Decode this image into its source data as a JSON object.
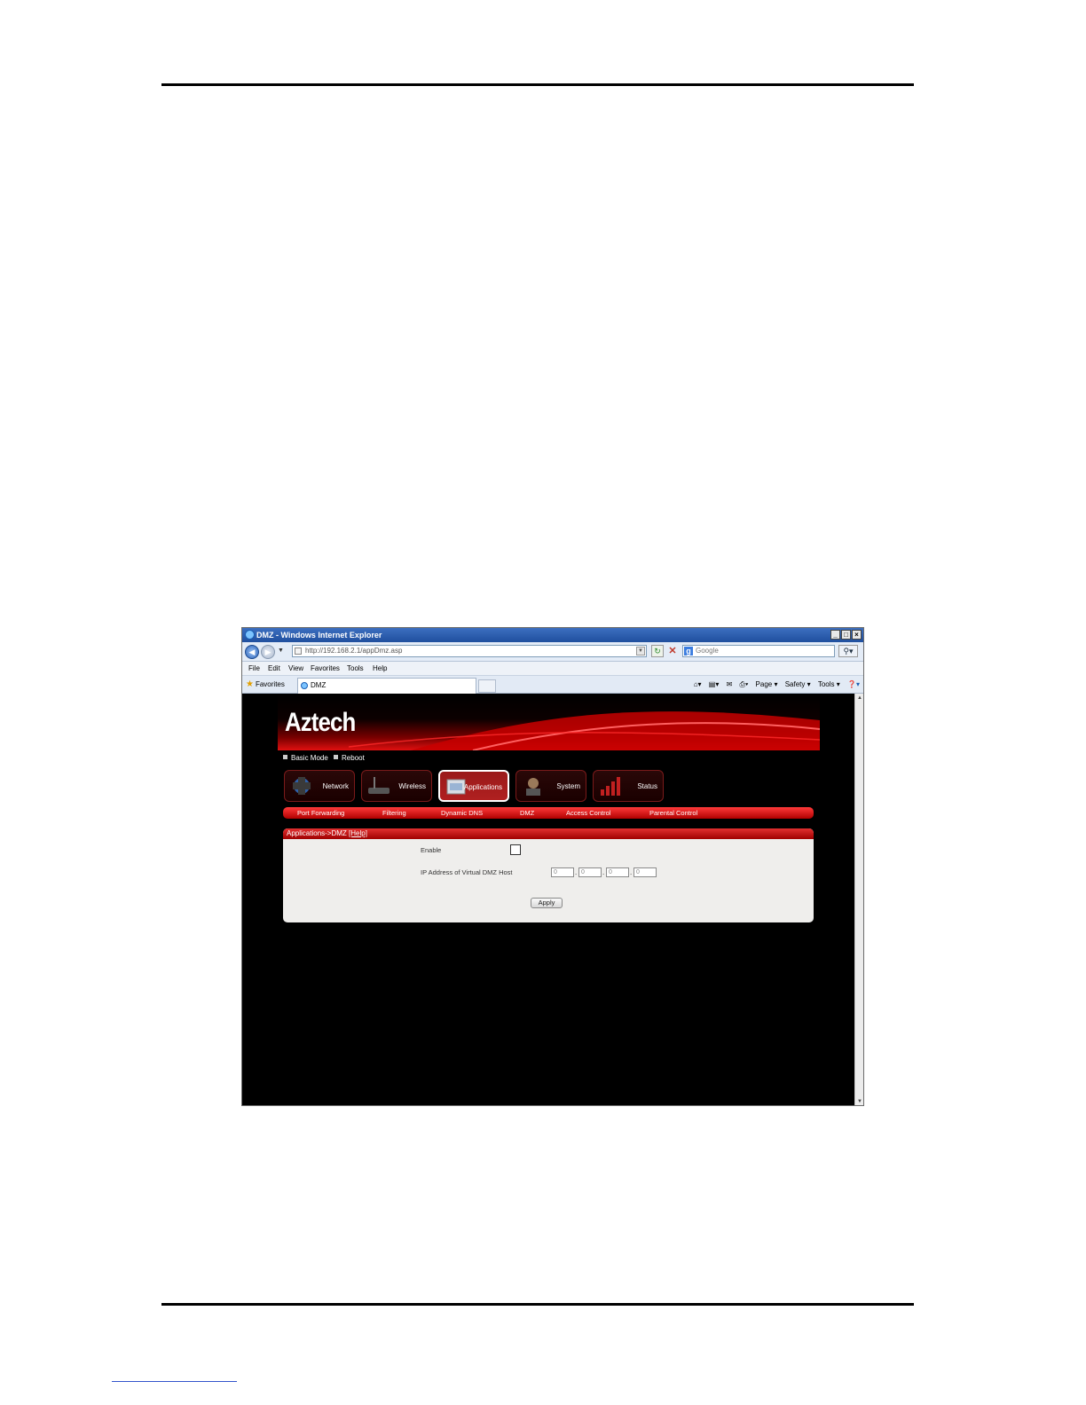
{
  "browser": {
    "window_title": "DMZ - Windows Internet Explorer",
    "url": "http://192.168.2.1/appDmz.asp",
    "search_placeholder": "Google",
    "menu": [
      "File",
      "Edit",
      "View",
      "Favorites",
      "Tools",
      "Help"
    ],
    "favorites_label": "Favorites",
    "tab_title": "DMZ",
    "command_bar": [
      "Page ▾",
      "Safety ▾",
      "Tools ▾"
    ]
  },
  "router": {
    "logo": "Aztech",
    "top_links": [
      "Basic Mode",
      "Reboot"
    ],
    "main_tabs": [
      {
        "label": "Network"
      },
      {
        "label": "Wireless"
      },
      {
        "label": "Applications"
      },
      {
        "label": "System"
      },
      {
        "label": "Status"
      }
    ],
    "active_tab": "Applications",
    "sub_nav": [
      "Port Forwarding",
      "Filtering",
      "Dynamic DNS",
      "DMZ",
      "Access Control",
      "Parental Control"
    ],
    "panel": {
      "breadcrumb": "Applications->DMZ",
      "help_link": "[Help]",
      "enable_label": "Enable",
      "enable_checked": false,
      "ip_label": "IP Address of Virtual DMZ Host",
      "ip_octets": [
        "0",
        "0",
        "0",
        "0"
      ],
      "apply_label": "Apply"
    }
  },
  "colors": {
    "accent_red": "#d01010",
    "page_background": "#000000"
  }
}
